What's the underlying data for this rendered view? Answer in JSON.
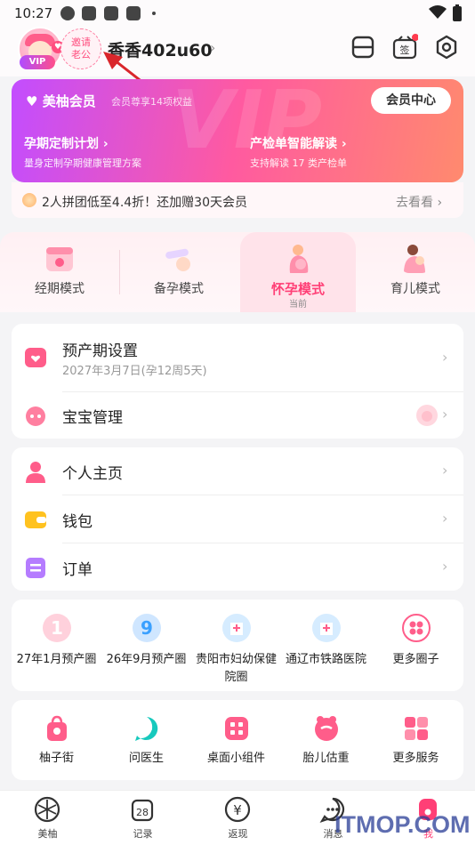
{
  "status_bar": {
    "time": "10:27"
  },
  "header": {
    "vip_badge": "VIP",
    "invite": {
      "line1": "邀请",
      "line2": "老公"
    },
    "username": "香香402u60"
  },
  "vip_card": {
    "title": "美柚会员",
    "subtitle": "会员尊享14项权益",
    "watermark": "VIP",
    "center_button": "会员中心",
    "features": [
      {
        "title": "孕期定制计划 ›",
        "desc": "量身定制孕期健康管理方案"
      },
      {
        "title": "产检单智能解读 ›",
        "desc": "支持解读 17 类产检单"
      }
    ]
  },
  "promo": {
    "text": "2人拼团低至4.4折！还加赠30天会员",
    "link": "去看看 ›"
  },
  "modes": [
    {
      "label": "经期模式",
      "icon": "calendar-icon",
      "color": "#ffc6d3"
    },
    {
      "label": "备孕模式",
      "icon": "ovulation-test-icon",
      "color": "#e6d4ff"
    },
    {
      "label": "怀孕模式",
      "icon": "pregnant-woman-icon",
      "color": "#ffb6c8",
      "current": "当前"
    },
    {
      "label": "育儿模式",
      "icon": "mother-baby-icon",
      "color": "#ffc9b6"
    }
  ],
  "pregnancy_card": {
    "due_date": {
      "title": "预产期设置",
      "sub": "2027年3月7日(孕12周5天)"
    },
    "baby": {
      "title": "宝宝管理"
    }
  },
  "personal_card": {
    "items": [
      {
        "title": "个人主页",
        "icon": "person-icon"
      },
      {
        "title": "钱包",
        "icon": "wallet-icon"
      },
      {
        "title": "订单",
        "icon": "order-icon"
      }
    ]
  },
  "circles": [
    {
      "label": "27年1月预产圈",
      "badge": "1",
      "color": "#ffd1dc"
    },
    {
      "label": "26年9月预产圈",
      "badge": "9",
      "color": "#cfe6ff"
    },
    {
      "label": "贵阳市妇幼保健院圈",
      "color": "#d6ecff"
    },
    {
      "label": "通辽市铁路医院",
      "color": "#d6ecff"
    },
    {
      "label": "更多圈子",
      "color": "#ffe2ea"
    }
  ],
  "services": [
    {
      "label": "柚子街",
      "icon": "shopping-bag-icon"
    },
    {
      "label": "问医生",
      "icon": "doctor-chat-icon"
    },
    {
      "label": "桌面小组件",
      "icon": "widget-icon"
    },
    {
      "label": "胎儿估重",
      "icon": "scale-icon"
    },
    {
      "label": "更多服务",
      "icon": "grid-icon"
    }
  ],
  "bottom_nav": [
    {
      "label": "美柚",
      "icon": "home-icon"
    },
    {
      "label": "记录",
      "icon": "calendar-28-icon",
      "day": "28"
    },
    {
      "label": "返现",
      "icon": "yuan-icon",
      "symbol": "¥"
    },
    {
      "label": "消息",
      "icon": "message-icon"
    },
    {
      "label": "我",
      "icon": "me-icon",
      "active": true
    }
  ],
  "watermark": "ITMOP.COM",
  "colors": {
    "accent": "#ff3f76",
    "vip_start": "#c24dff",
    "vip_end": "#ff8a6e",
    "annotation_arrow": "#d9262b"
  }
}
